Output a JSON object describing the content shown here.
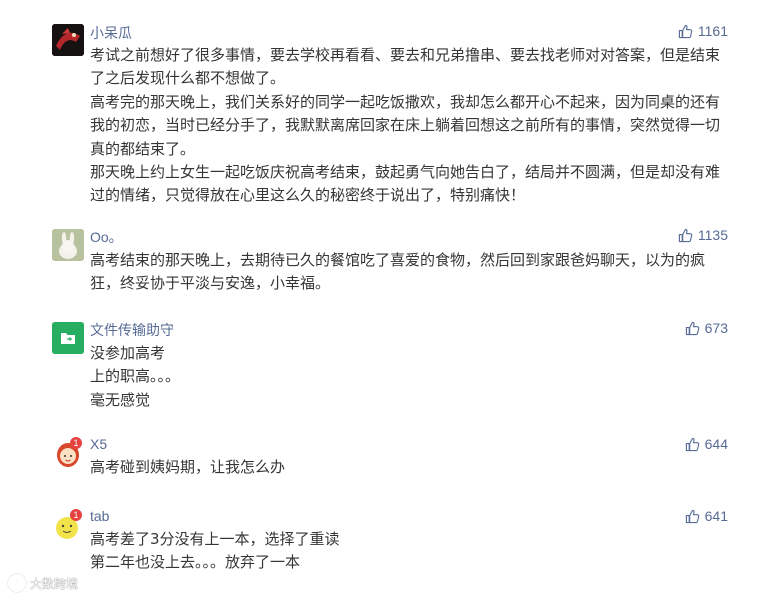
{
  "comments": [
    {
      "author": "小呆瓜",
      "likes": "1161",
      "paragraphs": [
        "考试之前想好了很多事情，要去学校再看看、要去和兄弟撸串、要去找老师对对答案，但是结束了之后发现什么都不想做了。",
        "高考完的那天晚上，我们关系好的同学一起吃饭撒欢，我却怎么都开心不起来，因为同桌的还有我的初恋，当时已经分手了，我默默离席回家在床上躺着回想这之前所有的事情，突然觉得一切真的都结束了。",
        "那天晚上约上女生一起吃饭庆祝高考结束，鼓起勇气向她告白了，结局并不圆满，但是却没有难过的情绪，只觉得放在心里这么久的秘密终于说出了，特别痛快！"
      ]
    },
    {
      "author": "Oo。",
      "likes": "1135",
      "paragraphs": [
        "高考结束的那天晚上，去期待已久的餐馆吃了喜爱的食物，然后回到家跟爸妈聊天，以为的疯狂，终妥协于平淡与安逸，小幸福。"
      ]
    },
    {
      "author": "文件传输助守",
      "likes": "673",
      "paragraphs": [
        "没参加高考",
        "上的职高。。。",
        "毫无感觉"
      ]
    },
    {
      "author": "X5",
      "likes": "644",
      "badge": "1",
      "paragraphs": [
        "高考碰到姨妈期，让我怎么办"
      ]
    },
    {
      "author": "tab",
      "likes": "641",
      "badge": "1",
      "paragraphs": [
        "高考差了3分没有上一本，选择了重读",
        "第二年也没上去。。。放弃了一本"
      ]
    }
  ],
  "watermark": "大数跨境",
  "colors": {
    "name": "#576b95",
    "text": "#353535",
    "badge": "#e64340",
    "file_transfer_green": "#27ae60"
  }
}
